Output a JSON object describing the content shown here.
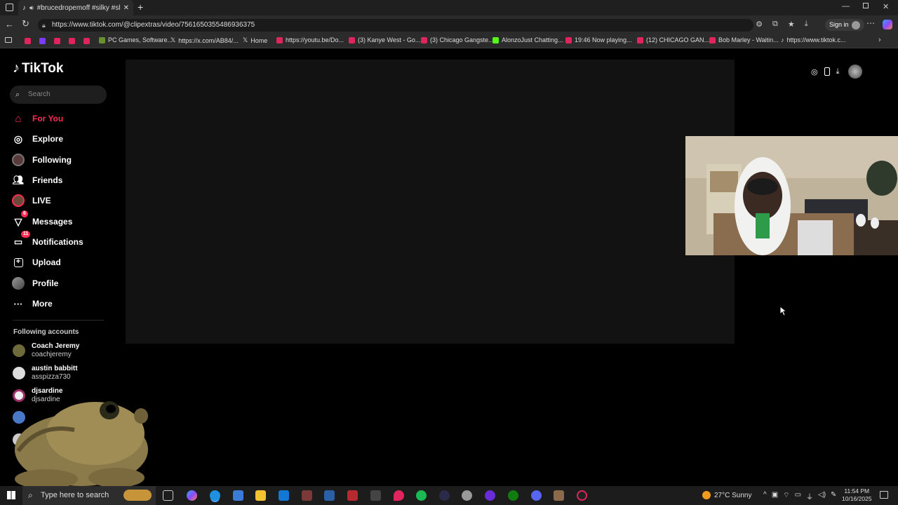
{
  "browser": {
    "tab_title": "#brucedropemoff #silky #sl",
    "url": "https://www.tiktok.com/@clipextras/video/7561650355486936375",
    "signin_label": "Sign in",
    "bookmarks": [
      "PC Games, Software...",
      "https://x.com/AB84/...",
      "Home",
      "https://youtu.be/Do...",
      "(3) Kanye West - Go...",
      "(3) Chicago Gangste...",
      "AlonzoJust Chatting...",
      "19:46 Now playing...",
      "(12) CHICAGO GAN...",
      "Bob Marley - Waitin...",
      "https://www.tiktok.c..."
    ]
  },
  "tiktok": {
    "logo": "TikTok",
    "search_placeholder": "Search",
    "nav": [
      {
        "label": "For You",
        "icon": "home-icon"
      },
      {
        "label": "Explore",
        "icon": "compass-icon"
      },
      {
        "label": "Following",
        "icon": "following-icon"
      },
      {
        "label": "Friends",
        "icon": "friends-icon"
      },
      {
        "label": "LIVE",
        "icon": "live-icon"
      },
      {
        "label": "Messages",
        "icon": "messages-icon",
        "badge": "6"
      },
      {
        "label": "Notifications",
        "icon": "inbox-icon",
        "badge": "11"
      },
      {
        "label": "Upload",
        "icon": "upload-icon"
      },
      {
        "label": "Profile",
        "icon": "profile-icon"
      },
      {
        "label": "More",
        "icon": "more-icon"
      }
    ],
    "following_title": "Following accounts",
    "accounts": [
      {
        "name": "Coach Jeremy",
        "handle": "coachjeremy"
      },
      {
        "name": "austin babbitt",
        "handle": "asspizza730"
      },
      {
        "name": "djsardine",
        "handle": "djsardine"
      }
    ]
  },
  "taskbar": {
    "search_placeholder": "Type here to search",
    "weather": "27°C  Sunny",
    "time": "11:54 PM",
    "date": "10/16/2025"
  },
  "colors": {
    "accent": "#fe2c55",
    "bg": "#000000"
  }
}
